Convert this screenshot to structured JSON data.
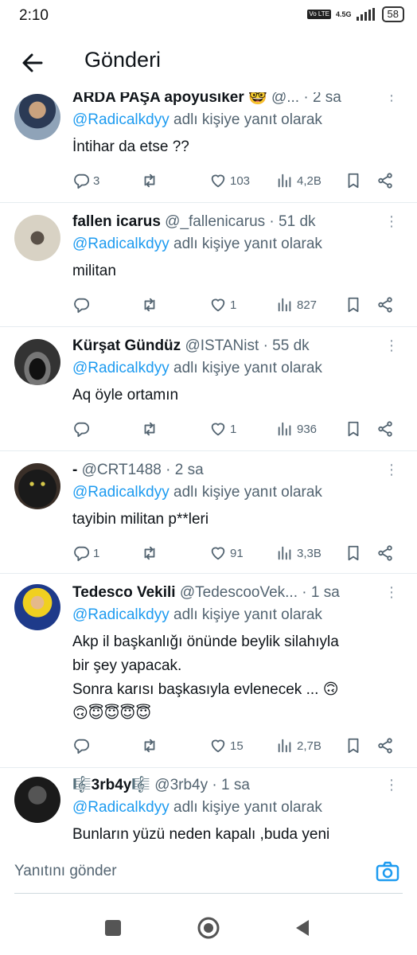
{
  "status_bar": {
    "time": "2:10",
    "volte": "Vo LTE",
    "network": "4.5G",
    "battery": "58"
  },
  "header": {
    "title": "Gönderi"
  },
  "tweets": [
    {
      "name": "ARDA PAŞA apoyusiker 🤓",
      "handle": "@...",
      "time": "· 2 sa",
      "reply_mention": "@Radicalkdyy",
      "reply_suffix": " adlı kişiye yanıt olarak",
      "text": "İntihar da etse ??",
      "replies": "3",
      "likes": "103",
      "views": "4,2B"
    },
    {
      "name": "fallen icarus",
      "handle": "@_fallenicarus",
      "time": "· 51 dk",
      "reply_mention": "@Radicalkdyy",
      "reply_suffix": " adlı kişiye yanıt olarak",
      "text": "militan",
      "replies": "",
      "likes": "1",
      "views": "827"
    },
    {
      "name": "Kürşat Gündüz",
      "handle": "@ISTANist",
      "time": "· 55 dk",
      "reply_mention": "@Radicalkdyy",
      "reply_suffix": " adlı kişiye yanıt olarak",
      "text": "Aq öyle ortamın",
      "replies": "",
      "likes": "1",
      "views": "936"
    },
    {
      "name": "-",
      "handle": "@CRT1488",
      "time": "· 2 sa",
      "reply_mention": "@Radicalkdyy",
      "reply_suffix": " adlı kişiye yanıt olarak",
      "text": "tayibin militan p**leri",
      "replies": "1",
      "likes": "91",
      "views": "3,3B"
    },
    {
      "name": "Tedesco Vekili",
      "handle": "@TedescooVek...",
      "time": "· 1 sa",
      "reply_mention": "@Radicalkdyy",
      "reply_suffix": " adlı kişiye yanıt olarak",
      "text_lines": [
        "Akp il başkanlığı önünde beylik silahıyla",
        "bir şey yapacak.",
        "Sonra karısı başkasıyla evlenecek ... 🙃",
        "🙃😇😇😇😇"
      ],
      "replies": "",
      "likes": "15",
      "views": "2,7B"
    },
    {
      "name": "🎼3rb4y🎼",
      "handle": "@3rb4y",
      "time": "· 1 sa",
      "reply_mention": "@Radicalkdyy",
      "reply_suffix": " adlı kişiye yanıt olarak",
      "text": "Bunların yüzü neden kapalı ,buda yeni"
    }
  ],
  "composer": {
    "placeholder": "Yanıtını gönder"
  },
  "icons": {
    "back": "arrow-left-icon",
    "reply": "comment-icon",
    "retweet": "retweet-icon",
    "like": "heart-icon",
    "views": "bar-chart-icon",
    "bookmark": "bookmark-icon",
    "share": "share-icon",
    "camera": "camera-icon"
  },
  "colors": {
    "accent": "#1d9bf0",
    "secondary_text": "#536471"
  }
}
